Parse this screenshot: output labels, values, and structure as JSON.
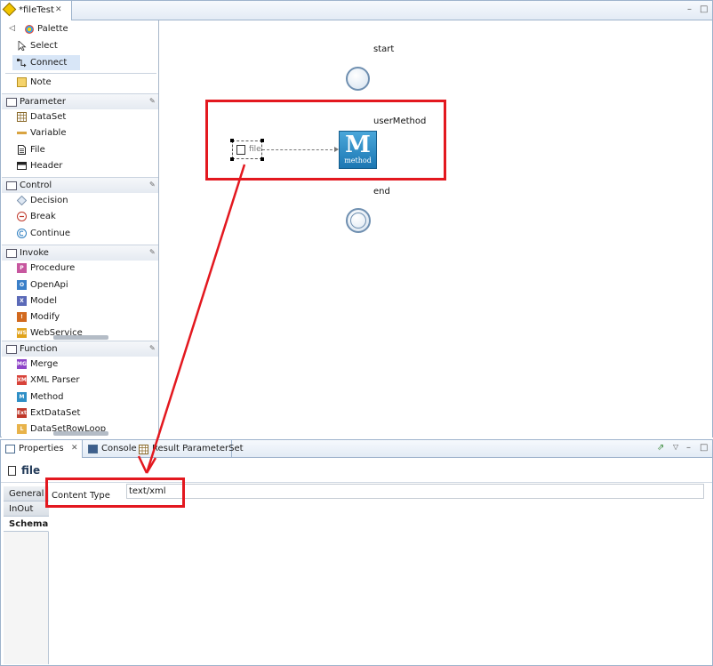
{
  "editor": {
    "tab_title": "*fileTest",
    "tab_close": "✕",
    "minimize": "–",
    "maximize": "□"
  },
  "palette": {
    "header": "Palette",
    "tools": [
      {
        "label": "Select",
        "icon": "cursor-icon"
      },
      {
        "label": "Connect",
        "icon": "connect-icon"
      },
      {
        "label": "Note",
        "icon": "note-icon"
      }
    ],
    "drawers": {
      "parameter": {
        "label": "Parameter",
        "items": [
          "DataSet",
          "Variable",
          "File",
          "Header"
        ]
      },
      "control": {
        "label": "Control",
        "items": [
          "Decision",
          "Break",
          "Continue"
        ]
      },
      "invoke": {
        "label": "Invoke",
        "items": [
          "Procedure",
          "OpenApi",
          "Model",
          "Modify",
          "WebService"
        ]
      },
      "function": {
        "label": "Function",
        "items": [
          "Merge",
          "XML Parser",
          "Method",
          "ExtDataSet",
          "DataSetRowLoop"
        ]
      }
    }
  },
  "canvas": {
    "start_label": "start",
    "method_label": "userMethod",
    "end_label": "end",
    "file_node_label": "file",
    "method_icon_big": "M",
    "method_icon_small": "method"
  },
  "properties": {
    "tabs": [
      "Properties",
      "Console",
      "Result ParameterSet"
    ],
    "title": "file",
    "side_tabs": [
      "General",
      "InOut",
      "Schema"
    ],
    "content_type_label": "Content Type",
    "content_type_value": "text/xml"
  },
  "colors": {
    "highlight": "#e3181f",
    "method_blue": "#2f8fc6"
  }
}
